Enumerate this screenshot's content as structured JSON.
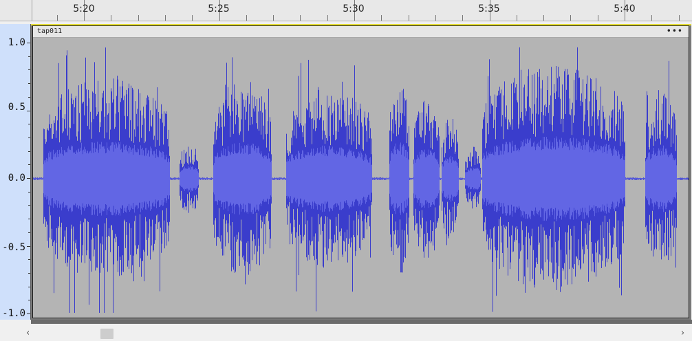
{
  "ruler": {
    "labels": [
      "5:20",
      "5:25",
      "5:30",
      "5:35",
      "5:40"
    ]
  },
  "vscale": {
    "labels": [
      "1.0",
      "0.5",
      "0.0",
      "-0.5",
      "-1.0"
    ]
  },
  "track": {
    "clip_name": "tap011",
    "menu_label": "•••"
  },
  "scrollbar": {
    "left_arrow": "‹",
    "right_arrow": "›"
  },
  "colors": {
    "waveform_peak": "#3a3dcc",
    "waveform_rms": "#6266e4",
    "clip_background": "#b4b4b4",
    "scale_background": "#cfe0fb",
    "selection_border": "#e6de34"
  }
}
